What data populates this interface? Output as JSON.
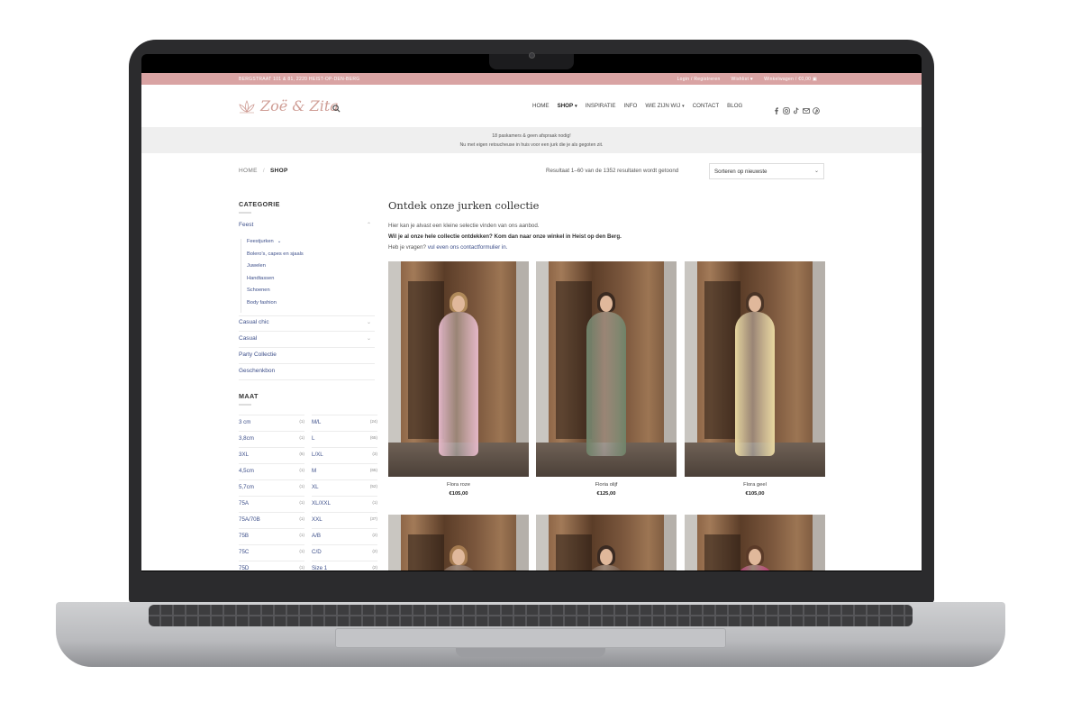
{
  "topbar": {
    "address": "BERGSTRAAT 101 & 81, 2220 HEIST-OP-DEN-BERG",
    "login": "Login / Registreren",
    "wishlist": "Wishlist",
    "cart": "Winkelwagen / €0,00"
  },
  "header": {
    "logo_text": "Zoë & Zita",
    "nav": [
      {
        "label": "HOME",
        "active": false,
        "dropdown": false
      },
      {
        "label": "SHOP",
        "active": true,
        "dropdown": true
      },
      {
        "label": "INSPIRATIE",
        "active": false,
        "dropdown": false
      },
      {
        "label": "INFO",
        "active": false,
        "dropdown": false
      },
      {
        "label": "WIE ZIJN WIJ",
        "active": false,
        "dropdown": true
      },
      {
        "label": "CONTACT",
        "active": false,
        "dropdown": false
      },
      {
        "label": "BLOG",
        "active": false,
        "dropdown": false
      }
    ],
    "social_icons": [
      "facebook-icon",
      "instagram-icon",
      "tiktok-icon",
      "mail-icon",
      "pinterest-icon"
    ]
  },
  "notice": {
    "line1": "18 paskamers & geen afspraak nodig!",
    "line2": "Nu met eigen retoucheuse in huis voor een jurk die je als gegoten zit."
  },
  "breadcrumb": {
    "home": "HOME",
    "separator": "/",
    "current": "SHOP"
  },
  "results_text": "Resultaat 1–60 van de 1352 resultaten wordt getoond",
  "sort": {
    "selected": "Sorteren op nieuwste"
  },
  "sidebar": {
    "category_heading": "CATEGORIE",
    "categories": [
      {
        "label": "Feest",
        "expandable": true
      },
      {
        "label": "Casual chic",
        "expandable": true
      },
      {
        "label": "Casual",
        "expandable": true
      },
      {
        "label": "Party Collectie",
        "expandable": false
      },
      {
        "label": "Geschenkbon",
        "expandable": false
      }
    ],
    "subcategories": [
      "Feestjurken",
      "Bolero's, capes en sjaals",
      "Juwelen",
      "Handtassen",
      "Schoenen",
      "Body fashion"
    ],
    "size_heading": "MAAT",
    "sizes_left": [
      {
        "label": "3 cm",
        "count": "(1)"
      },
      {
        "label": "3,8cm",
        "count": "(1)"
      },
      {
        "label": "3XL",
        "count": "(6)"
      },
      {
        "label": "4,5cm",
        "count": "(1)"
      },
      {
        "label": "5,7cm",
        "count": "(1)"
      },
      {
        "label": "75A",
        "count": "(1)"
      },
      {
        "label": "75A/70B",
        "count": "(1)"
      },
      {
        "label": "75B",
        "count": "(1)"
      },
      {
        "label": "75C",
        "count": "(1)"
      },
      {
        "label": "75D",
        "count": "(1)"
      }
    ],
    "sizes_right": [
      {
        "label": "M/L",
        "count": "(24)"
      },
      {
        "label": "L",
        "count": "(65)"
      },
      {
        "label": "L/XL",
        "count": "(3)"
      },
      {
        "label": "M",
        "count": "(65)"
      },
      {
        "label": "XL",
        "count": "(52)"
      },
      {
        "label": "XL/XXL",
        "count": "(1)"
      },
      {
        "label": "XXL",
        "count": "(37)"
      },
      {
        "label": "A/B",
        "count": "(2)"
      },
      {
        "label": "C/D",
        "count": "(2)"
      },
      {
        "label": "Size 1",
        "count": "(2)"
      }
    ]
  },
  "main": {
    "title": "Ontdek onze jurken collectie",
    "intro_line1": "Hier kan je alvast een kleine selectie vinden van ons aanbod.",
    "intro_line2": "Wil je al onze hele collectie ontdekken? Kom dan naar onze winkel in Heist op den Berg.",
    "intro_line3_prefix": "Heb je vragen?",
    "intro_line3_link": "vul even ons contactformulier in.",
    "products": [
      {
        "name": "Flora roze",
        "price": "€105,00",
        "dress_color": "#e3b6c6",
        "hair_color": "#b08a5a"
      },
      {
        "name": "Floria olijf",
        "price": "€125,00",
        "dress_color": "#6f8268",
        "hair_color": "#3b2a20"
      },
      {
        "name": "Flora geel",
        "price": "€105,00",
        "dress_color": "#e8d7a0",
        "hair_color": "#4a3426"
      },
      {
        "name": "",
        "price": "",
        "dress_color": "#7a5a48",
        "hair_color": "#a57b50"
      },
      {
        "name": "",
        "price": "",
        "dress_color": "#6a4e3c",
        "hair_color": "#3a2a22"
      },
      {
        "name": "",
        "price": "",
        "dress_color": "#c42a7a",
        "hair_color": "#5a3a28"
      }
    ]
  },
  "colors": {
    "accent": "#d9a3a3",
    "link": "#3d4f8a",
    "logo": "#cf9d95"
  }
}
